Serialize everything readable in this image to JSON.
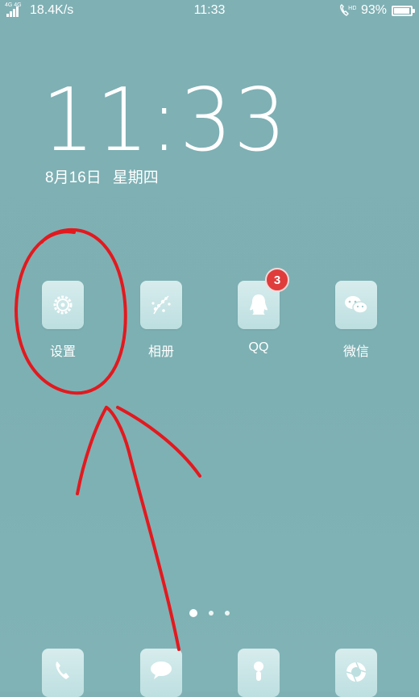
{
  "status_bar": {
    "net_type": "4G 4G",
    "speed": "18.4K/s",
    "time": "11:33",
    "hd": "HD",
    "battery_percent": "93%",
    "battery_level": 0.93
  },
  "lockscreen": {
    "clock": "11:33",
    "date": "8月16日",
    "weekday": "星期四"
  },
  "apps": [
    {
      "label": "设置",
      "icon": "gear-icon"
    },
    {
      "label": "相册",
      "icon": "flower-icon"
    },
    {
      "label": "QQ",
      "icon": "penguin-icon",
      "badge": "3"
    },
    {
      "label": "微信",
      "icon": "wechat-icon"
    }
  ],
  "page_indicator": {
    "count": 3,
    "active": 0
  },
  "dock": [
    {
      "icon": "phone-icon"
    },
    {
      "icon": "message-icon"
    },
    {
      "icon": "contacts-icon"
    },
    {
      "icon": "camera-icon"
    }
  ],
  "colors": {
    "background": "#7fb0b4",
    "badge": "#e03c3c",
    "annotation": "#e3191e"
  }
}
